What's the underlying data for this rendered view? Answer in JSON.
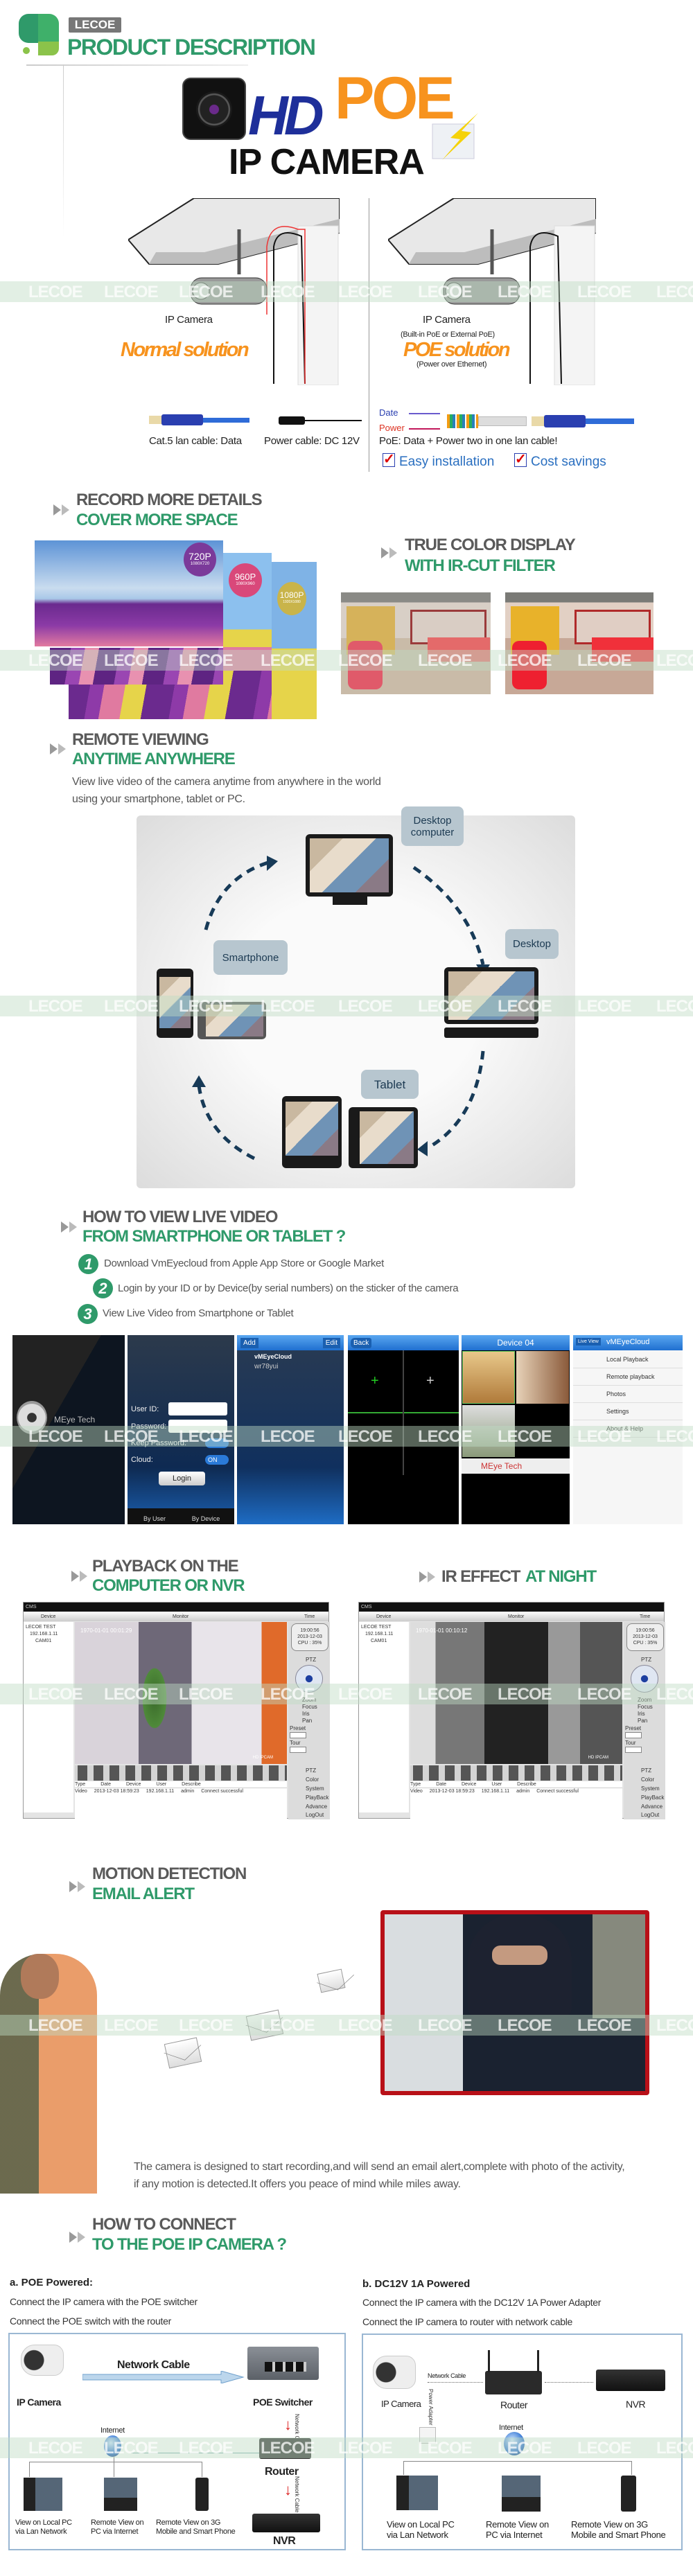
{
  "brand": {
    "logo_text": "LECOE",
    "title": "PRODUCT DESCRIPTION",
    "accent_green": "#2f9a6a",
    "heading_gray": "#5a5a5a",
    "accent_orange": "#f7931e"
  },
  "watermark": "LECOE",
  "hero": {
    "hd": "HD",
    "poe": "POE",
    "subtitle": "IP CAMERA"
  },
  "comparison": {
    "normal": {
      "camera_label": "IP Camera",
      "title": "Normal solution",
      "cable_data": "Cat.5 lan cable: Data",
      "cable_power": "Power cable: DC 12V"
    },
    "poe": {
      "camera_label": "IP Camera",
      "note": "(Built-in PoE or External PoE)",
      "title": "POE solution",
      "subnote": "(Power over Ethernet)",
      "legend_data": "Date",
      "legend_power": "Power",
      "summary": "PoE: Data + Power two in one lan cable!",
      "benefits": [
        "Easy installation",
        "Cost savings"
      ]
    }
  },
  "record": {
    "line1": "RECORD MORE DETAILS",
    "line2": "COVER MORE SPACE",
    "badges": [
      {
        "res": "720P",
        "dims": "1080X720",
        "color": "#7b3a9a"
      },
      {
        "res": "960P",
        "dims": "1080X960",
        "color": "#d9487a"
      },
      {
        "res": "1080P",
        "dims": "1920X1080",
        "color": "#c9b44a"
      }
    ]
  },
  "truecolor": {
    "line1": "TRUE COLOR DISPLAY",
    "line2": "WITH IR-CUT FILTER"
  },
  "remote": {
    "line1": "REMOTE VIEWING",
    "line2": "ANYTIME ANYWHERE",
    "desc1": "View live video of the camera anytime from anywhere in the world",
    "desc2": "using your smartphone, tablet or PC.",
    "devices": {
      "desktop_computer": "Desktop computer",
      "desktop": "Desktop",
      "tablet": "Tablet",
      "smartphone": "Smartphone"
    }
  },
  "howto": {
    "line1": "HOW TO VIEW LIVE VIDEO",
    "line2": "FROM SMARTPHONE OR TABLET ?",
    "steps": [
      {
        "num": "1",
        "text": "Download VmEyecloud from Apple App Store or Google Market"
      },
      {
        "num": "2",
        "text": "Login by your ID or by Device(by serial numbers) on the sticker of the camera"
      },
      {
        "num": "3",
        "text": "View Live Video from Smartphone or Tablet"
      }
    ]
  },
  "app": {
    "splash": "MEye Tech",
    "login": {
      "user_id": "User ID:",
      "password": "Password:",
      "keep": "Keep Password:",
      "cloud": "Cloud:",
      "on": "ON",
      "login": "Login",
      "by_user": "By User",
      "by_device": "By Device"
    },
    "list": {
      "add": "Add",
      "edit": "Edit",
      "cloud": "vMEyeCloud",
      "device": "wr78yui"
    },
    "grid": {
      "back": "Back",
      "keys": [
        "1",
        "3",
        "5",
        "7",
        "2",
        "4",
        "6",
        "8"
      ]
    },
    "device": {
      "title": "Device 04",
      "ad": "MEye Tech"
    },
    "menu": {
      "live": "Live View",
      "title": "vMEyeCloud",
      "items": [
        "Local Playback",
        "Remote playback",
        "Photos",
        "Settings",
        "About & Help"
      ]
    }
  },
  "playback": {
    "line1": "PLAYBACK ON THE",
    "line2": "COMPUTER OR NVR"
  },
  "ir": {
    "line1": "IR EFFECT",
    "line2": "AT NIGHT"
  },
  "cms": {
    "title": "CMS",
    "device": "Device",
    "monitor": "Monitor",
    "time": "Time",
    "tree": [
      "LECOE TEST",
      "192.168.1.11",
      "CAM01"
    ],
    "clock": "19:00:56",
    "date": "2013-12-03",
    "cpu": "CPU : 35%",
    "overlay_day": "1970-01-01 00:01:29",
    "overlay_night": "1970-01-01 00:10:12",
    "cam_tag": "HD IPCAM",
    "ptz": "PTZ",
    "controls": [
      "Zoom",
      "Focus",
      "Iris",
      "Pan"
    ],
    "preset": "Preset",
    "tour": "Tour",
    "menu": [
      "PTZ",
      "Color",
      "System",
      "PlayBack",
      "Advance",
      "LogOut"
    ],
    "log_headers": [
      "Type",
      "Date",
      "Device",
      "User",
      "Describe"
    ],
    "log_row": [
      "Video",
      "2013-12-03 18:59:23",
      "192.168.1.11",
      "admin",
      "Connect successful"
    ]
  },
  "motion": {
    "line1": "MOTION DETECTION",
    "line2": "EMAIL ALERT",
    "desc1": "The camera is designed to start recording,and will send an email alert,complete with photo of the activity,",
    "desc2": "if any motion is detected.It offers you peace of mind while miles away."
  },
  "connect": {
    "line1": "HOW TO CONNECT",
    "line2": "TO THE POE IP CAMERA ?",
    "a": {
      "title": "a.  POE Powered:",
      "line1": "Connect the IP camera with the POE switcher",
      "line2": "Connect the POE switch with the router",
      "labels": {
        "camera": "IP Camera",
        "cable": "Network Cable",
        "switch": "POE Switcher",
        "internet": "Internet",
        "router": "Router",
        "nvr": "NVR",
        "vcable": "Network Cable"
      },
      "clients": [
        [
          "View on Local PC",
          "via Lan Network"
        ],
        [
          "Remote View on",
          "PC via Internet"
        ],
        [
          "Remote View on 3G",
          "Mobile and Smart Phone"
        ]
      ]
    },
    "b": {
      "title": "b. DC12V 1A Powered",
      "line1": "Connect the IP camera with the DC12V 1A Power Adapter",
      "line2": "Connect the IP camera to router with network cable",
      "labels": {
        "camera": "IP Camera",
        "cable": "Network Cable",
        "router": "Router",
        "nvr": "NVR",
        "adapter": "Power Adapter",
        "internet": "Internet"
      },
      "clients": [
        [
          "View on Local PC",
          "via Lan Network"
        ],
        [
          "Remote View on",
          "PC via Internet"
        ],
        [
          "Remote View on 3G",
          "Mobile and Smart Phone"
        ]
      ]
    }
  }
}
